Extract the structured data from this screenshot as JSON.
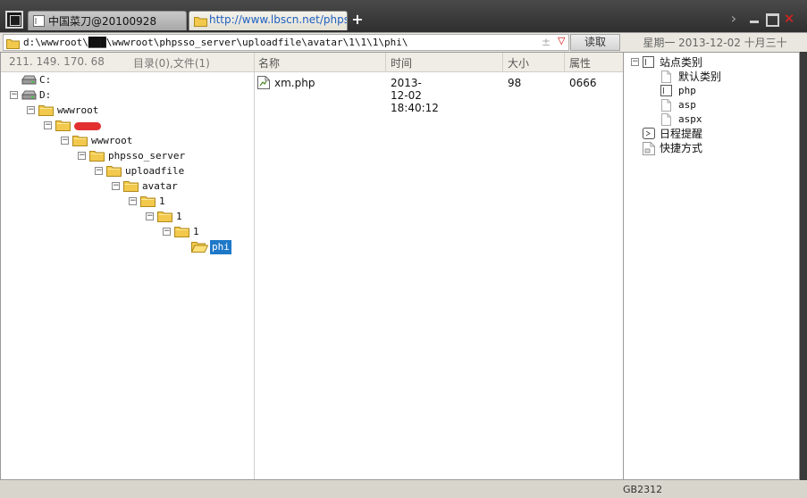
{
  "tabs": [
    {
      "label": "中国菜刀@20100928",
      "icon": "page-icon",
      "active": false
    },
    {
      "label": "http://www.lbscn.net/phpsso...",
      "icon": "folder-icon",
      "active": true
    }
  ],
  "address": {
    "value": "d:\\wwwroot\\███\\wwwroot\\phpsso_server\\uploadfile\\avatar\\1\\1\\1\\phi\\",
    "history_symbol": "±",
    "dropdown_symbol": "▽",
    "read_label": "读取"
  },
  "date_label": "星期一 2013-12-02 十月三十",
  "left_header": {
    "ip": "211. 149. 170. 68",
    "count": "目录(0),文件(1)"
  },
  "file_columns": {
    "name": "名称",
    "time": "时间",
    "size": "大小",
    "attr": "属性"
  },
  "tree": [
    {
      "label": "C:",
      "type": "drive",
      "depth": 0,
      "toggle": ""
    },
    {
      "label": "D:",
      "type": "drive",
      "depth": 0,
      "toggle": "−"
    },
    {
      "label": "wwwroot",
      "type": "folder",
      "depth": 1,
      "toggle": "−"
    },
    {
      "label": "",
      "type": "folder",
      "depth": 2,
      "toggle": "−",
      "redacted": true
    },
    {
      "label": "wwwroot",
      "type": "folder",
      "depth": 3,
      "toggle": "−"
    },
    {
      "label": "phpsso_server",
      "type": "folder",
      "depth": 4,
      "toggle": "−"
    },
    {
      "label": "uploadfile",
      "type": "folder",
      "depth": 5,
      "toggle": "−"
    },
    {
      "label": "avatar",
      "type": "folder",
      "depth": 6,
      "toggle": "−"
    },
    {
      "label": "1",
      "type": "folder",
      "depth": 7,
      "toggle": "−"
    },
    {
      "label": "1",
      "type": "folder",
      "depth": 8,
      "toggle": "−"
    },
    {
      "label": "1",
      "type": "folder",
      "depth": 9,
      "toggle": "−"
    },
    {
      "label": "phi",
      "type": "folder",
      "depth": 10,
      "toggle": "",
      "selected": true
    }
  ],
  "files": [
    {
      "name": "xm.php",
      "time": "2013-12-02 18:40:12",
      "size": "98",
      "attr": "0666"
    }
  ],
  "sites": [
    {
      "label": "站点类别",
      "depth": 0,
      "toggle": "−",
      "icon": "page-icon",
      "mono": false
    },
    {
      "label": "默认类别",
      "depth": 1,
      "toggle": "",
      "icon": "page-faded-icon",
      "mono": false
    },
    {
      "label": "php",
      "depth": 1,
      "toggle": "",
      "icon": "page-icon",
      "mono": true
    },
    {
      "label": "asp",
      "depth": 1,
      "toggle": "",
      "icon": "page-faded-icon",
      "mono": true
    },
    {
      "label": "aspx",
      "depth": 1,
      "toggle": "",
      "icon": "page-faded-icon",
      "mono": true
    },
    {
      "label": "日程提醒",
      "depth": 0,
      "toggle": "",
      "icon": "calendar-icon",
      "mono": false
    },
    {
      "label": "快捷方式",
      "depth": 0,
      "toggle": "",
      "icon": "shortcut-icon",
      "mono": false
    }
  ],
  "status": {
    "encoding": "GB2312"
  },
  "colors": {
    "selection": "#1e78c8",
    "folder": "#f2c94c",
    "close": "#e02020"
  }
}
